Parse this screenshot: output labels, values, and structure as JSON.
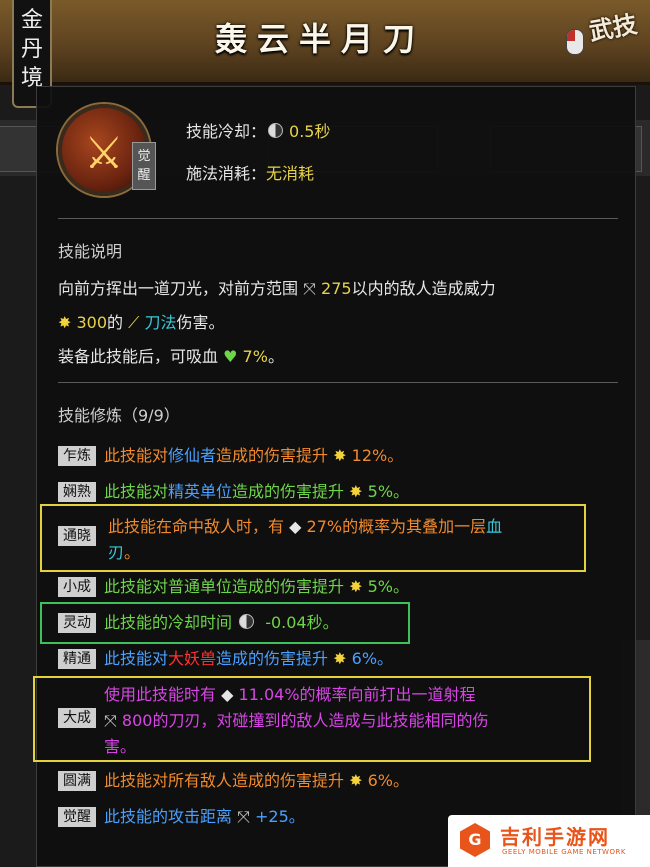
{
  "header": {
    "title": "轰云半月刀",
    "realm_tab": "金丹境",
    "corner_label": "武技"
  },
  "skill": {
    "icon_glyph": "⚔",
    "awaken_badge": "觉醒",
    "cooldown_label": "技能冷却：",
    "cooldown_value": "0.5秒",
    "cost_label": "施法消耗：",
    "cost_value": "无消耗"
  },
  "description": {
    "title": "技能说明",
    "line1_a": "向前方挥出一道刀光，对前方范围",
    "line1_range": "275",
    "line1_b": "以内的敌人造成威力",
    "line2_power": "300",
    "line2_a": "的",
    "line2_type": "刀法",
    "line2_b": "伤害。",
    "line3_a": "装备此技能后，可吸血",
    "line3_value": "7%",
    "line3_b": "。"
  },
  "training": {
    "title": "技能修炼（9/9）",
    "rows": [
      {
        "stage": "乍炼",
        "parts": [
          "此技能对",
          "修仙者",
          "造成的伤害提升",
          "12%",
          "。"
        ]
      },
      {
        "stage": "娴熟",
        "parts": [
          "此技能对",
          "精英单位",
          "造成的伤害提升",
          "5%",
          "。"
        ]
      },
      {
        "stage": "通晓",
        "parts": [
          "此技能在命中敌人时，有",
          "27%",
          "的概率为其叠加一层",
          "血",
          "刃",
          "。"
        ]
      },
      {
        "stage": "小成",
        "parts": [
          "此技能对普通单位造成的伤害提升",
          "5%",
          "。"
        ]
      },
      {
        "stage": "灵动",
        "parts": [
          "此技能的冷却时间",
          "-0.04秒",
          "。"
        ]
      },
      {
        "stage": "精通",
        "parts": [
          "此技能对",
          "大妖兽",
          "造成的伤害提升",
          "6%",
          "。"
        ]
      },
      {
        "stage": "大成",
        "parts": [
          "使用此技能时有",
          "11.04%",
          "的概率向前打出一道射程",
          "800",
          "的刀刃，对碰撞到的敌人造成与此技能相同的伤",
          "害",
          "。"
        ]
      },
      {
        "stage": "圆满",
        "parts": [
          "此技能对所有敌人造成的伤害提升",
          "6%",
          "。"
        ]
      },
      {
        "stage": "觉醒",
        "parts": [
          "此技能的攻击距离",
          "+25",
          "。"
        ]
      }
    ]
  },
  "watermark": {
    "logo": "G",
    "name": "吉利手游网",
    "sub": "GEELY MOBILE GAME NETWORK"
  },
  "colors": {
    "banner": "#6a4c24",
    "accent_yellow": "#e6d34a",
    "accent_orange": "#f08a2e",
    "accent_green": "#6ed54a",
    "accent_blue": "#4aa0ff",
    "accent_red": "#ff3030",
    "accent_purple": "#d845e6",
    "highlight_yellow": "#e3d23a",
    "highlight_green": "#3ec15a"
  }
}
